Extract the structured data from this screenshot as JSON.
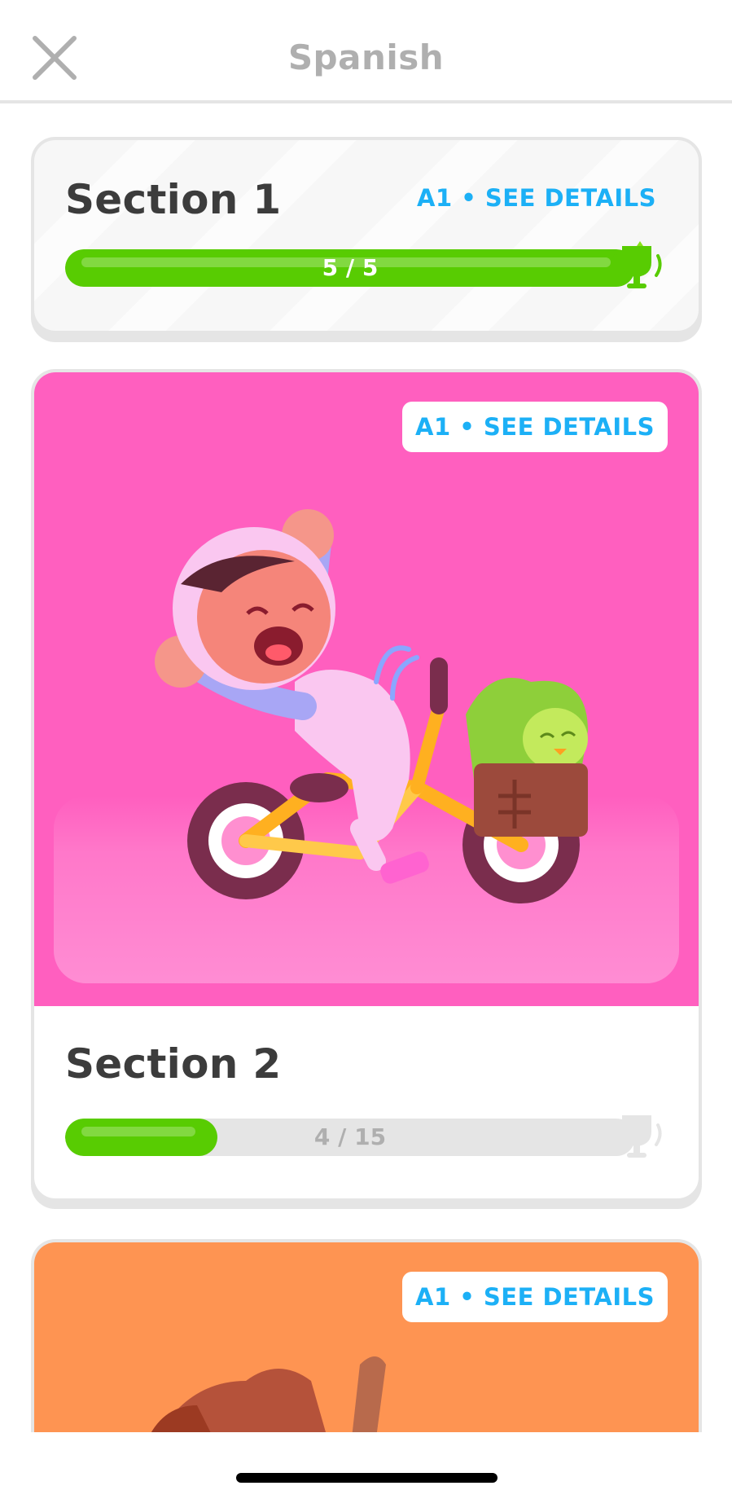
{
  "header": {
    "title": "Spanish",
    "close_icon": "close-icon"
  },
  "sections": [
    {
      "title": "Section 1",
      "details_label": "A1 • SEE DETAILS",
      "progress_label": "5 / 5",
      "progress_fraction": 1.0,
      "trophy_state": "earned"
    },
    {
      "title": "Section 2",
      "details_label": "A1 • SEE DETAILS",
      "progress_label": "4 / 15",
      "progress_fraction": 0.2667,
      "trophy_state": "locked",
      "illustration": "character-riding-bicycle-with-owl-in-basket"
    },
    {
      "title": "",
      "details_label": "A1 • SEE DETAILS",
      "illustration": "character-illustration-partial"
    }
  ],
  "colors": {
    "accent_blue": "#1cb0f6",
    "progress_green": "#58cc02",
    "trophy_green": "#58cc02",
    "trophy_gray": "#e5e5e5",
    "section2_bg": "#ff5fbf",
    "section3_bg": "#fe9452"
  }
}
